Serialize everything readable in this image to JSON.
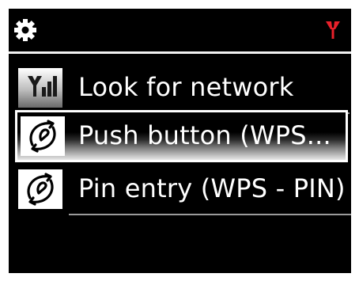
{
  "status_bar": {
    "settings_icon": "gear-icon",
    "network_icon": "antenna-icon",
    "network_icon_color": "#e8202a"
  },
  "menu": {
    "items": [
      {
        "label": "Look for network",
        "icon": "signal-bars-icon",
        "selected": false
      },
      {
        "label": "Push button (WPS...",
        "icon": "wps-icon",
        "selected": true
      },
      {
        "label": "Pin entry (WPS - PIN)",
        "icon": "wps-icon",
        "selected": false
      }
    ]
  },
  "colors": {
    "background": "#000000",
    "text": "#ffffff",
    "selection_border": "#ffffff"
  }
}
